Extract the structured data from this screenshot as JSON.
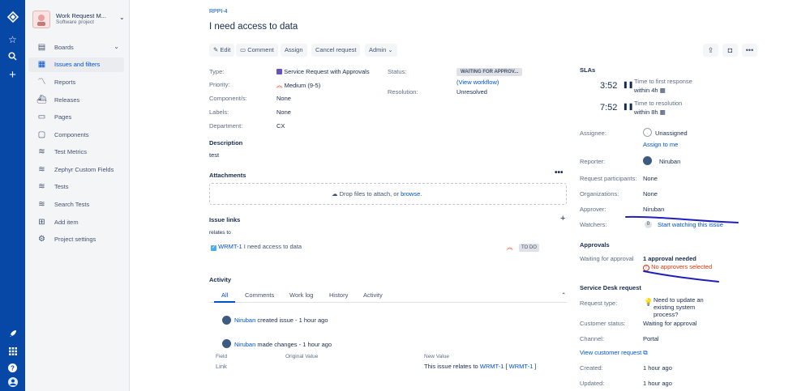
{
  "colors": {
    "global_nav": "#0747a6",
    "link": "#0052cc",
    "error": "#de350b",
    "annotation_ink": "#1f1fbf"
  },
  "project": {
    "name": "Work Request M...",
    "type": "Software project"
  },
  "sidebar": {
    "items": [
      {
        "label": "Boards",
        "icon": "board-icon"
      },
      {
        "label": "Issues and filters",
        "icon": "issues-icon"
      },
      {
        "label": "Reports",
        "icon": "chart-icon"
      },
      {
        "label": "Releases",
        "icon": "ship-icon"
      },
      {
        "label": "Pages",
        "icon": "page-icon"
      },
      {
        "label": "Components",
        "icon": "component-icon"
      },
      {
        "label": "Test Metrics",
        "icon": "metrics-icon"
      },
      {
        "label": "Zephyr Custom Fields",
        "icon": "zephyr-icon"
      },
      {
        "label": "Tests",
        "icon": "tests-icon"
      },
      {
        "label": "Search Tests",
        "icon": "search-icon"
      },
      {
        "label": "Add item",
        "icon": "add-icon"
      },
      {
        "label": "Project settings",
        "icon": "gear-icon"
      }
    ]
  },
  "issue": {
    "key": "RPPI-4",
    "title": "I need access to data"
  },
  "toolbar": {
    "edit": "Edit",
    "comment": "Comment",
    "assign": "Assign",
    "cancel": "Cancel request",
    "admin": "Admin"
  },
  "details": {
    "type_label": "Type:",
    "type_value": "Service Request with Approvals",
    "priority_label": "Priority:",
    "priority_value": "Medium (9-5)",
    "components_label": "Component/s:",
    "components_value": "None",
    "labels_label": "Labels:",
    "labels_value": "None",
    "department_label": "Department:",
    "department_value": "CX",
    "status_label": "Status:",
    "status_value": "WAITING FOR APPROV...",
    "view_workflow": "(View workflow)",
    "resolution_label": "Resolution:",
    "resolution_value": "Unresolved"
  },
  "description": {
    "heading": "Description",
    "text": "test"
  },
  "attachments": {
    "heading": "Attachments",
    "drop_text": "Drop files to attach, or",
    "browse": "browse."
  },
  "issue_links": {
    "heading": "Issue links",
    "relation": "relates to",
    "key": "WRMT-1",
    "summary": "I need access to data",
    "status": "TO DO"
  },
  "activity": {
    "heading": "Activity",
    "tabs": [
      "All",
      "Comments",
      "Work log",
      "History",
      "Activity"
    ],
    "entries": [
      {
        "user": "Niruban",
        "text": "created issue - 1 hour ago"
      },
      {
        "user": "Niruban",
        "text": "made changes - 1 hour ago"
      }
    ],
    "change": {
      "field_h": "Field",
      "orig_h": "Original Value",
      "new_h": "New Value",
      "field": "Link",
      "new_prefix": "This issue relates to",
      "new_key1": "WRMT-1",
      "new_bracket_open": "[",
      "new_key2": "WRMT-1",
      "new_bracket_close": "]"
    }
  },
  "slas": {
    "heading": "SLAs",
    "items": [
      {
        "time": "3:52",
        "name": "Time to first response",
        "target": "within 4h"
      },
      {
        "time": "7:52",
        "name": "Time to resolution",
        "target": "within 8h"
      }
    ]
  },
  "people": {
    "assignee_label": "Assignee:",
    "assignee_value": "Unassigned",
    "assign_to_me": "Assign to me",
    "reporter_label": "Reporter:",
    "reporter_value": "Niruban",
    "participants_label": "Request participants:",
    "participants_value": "None",
    "orgs_label": "Organizations:",
    "orgs_value": "None",
    "approver_label": "Approver:",
    "approver_value": "Niruban",
    "watchers_label": "Watchers:",
    "watchers_count": "0",
    "start_watching": "Start watching this issue"
  },
  "approvals": {
    "heading": "Approvals",
    "label": "Waiting for approval",
    "needed": "1 approval needed",
    "error": "No approvers selected"
  },
  "service_desk": {
    "heading": "Service Desk request",
    "type_label": "Request type:",
    "type_value": "Need to update an existing system process?",
    "status_label": "Customer status:",
    "status_value": "Waiting for approval",
    "channel_label": "Channel:",
    "channel_value": "Portal",
    "view_customer": "View customer request"
  },
  "dates": {
    "created_label": "Created:",
    "created_value": "1 hour ago",
    "updated_label": "Updated:",
    "updated_value": "1 hour ago"
  }
}
